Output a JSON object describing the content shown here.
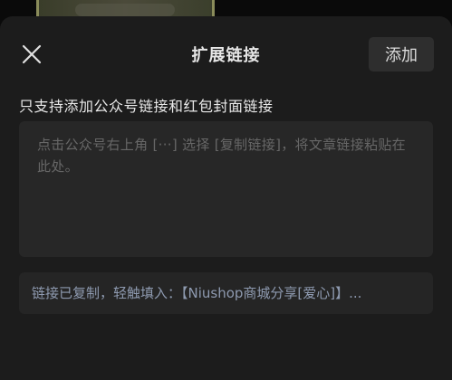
{
  "header": {
    "title": "扩展链接",
    "add_label": "添加"
  },
  "hint": "只支持添加公众号链接和红包封面链接",
  "link_input": {
    "value": "",
    "placeholder": "点击公众号右上角 [···] 选择 [复制链接]，将文章链接粘贴在此处。"
  },
  "clipboard_suggestion": "链接已复制，轻触填入：【Niushop商城分享[爱心]】..."
}
